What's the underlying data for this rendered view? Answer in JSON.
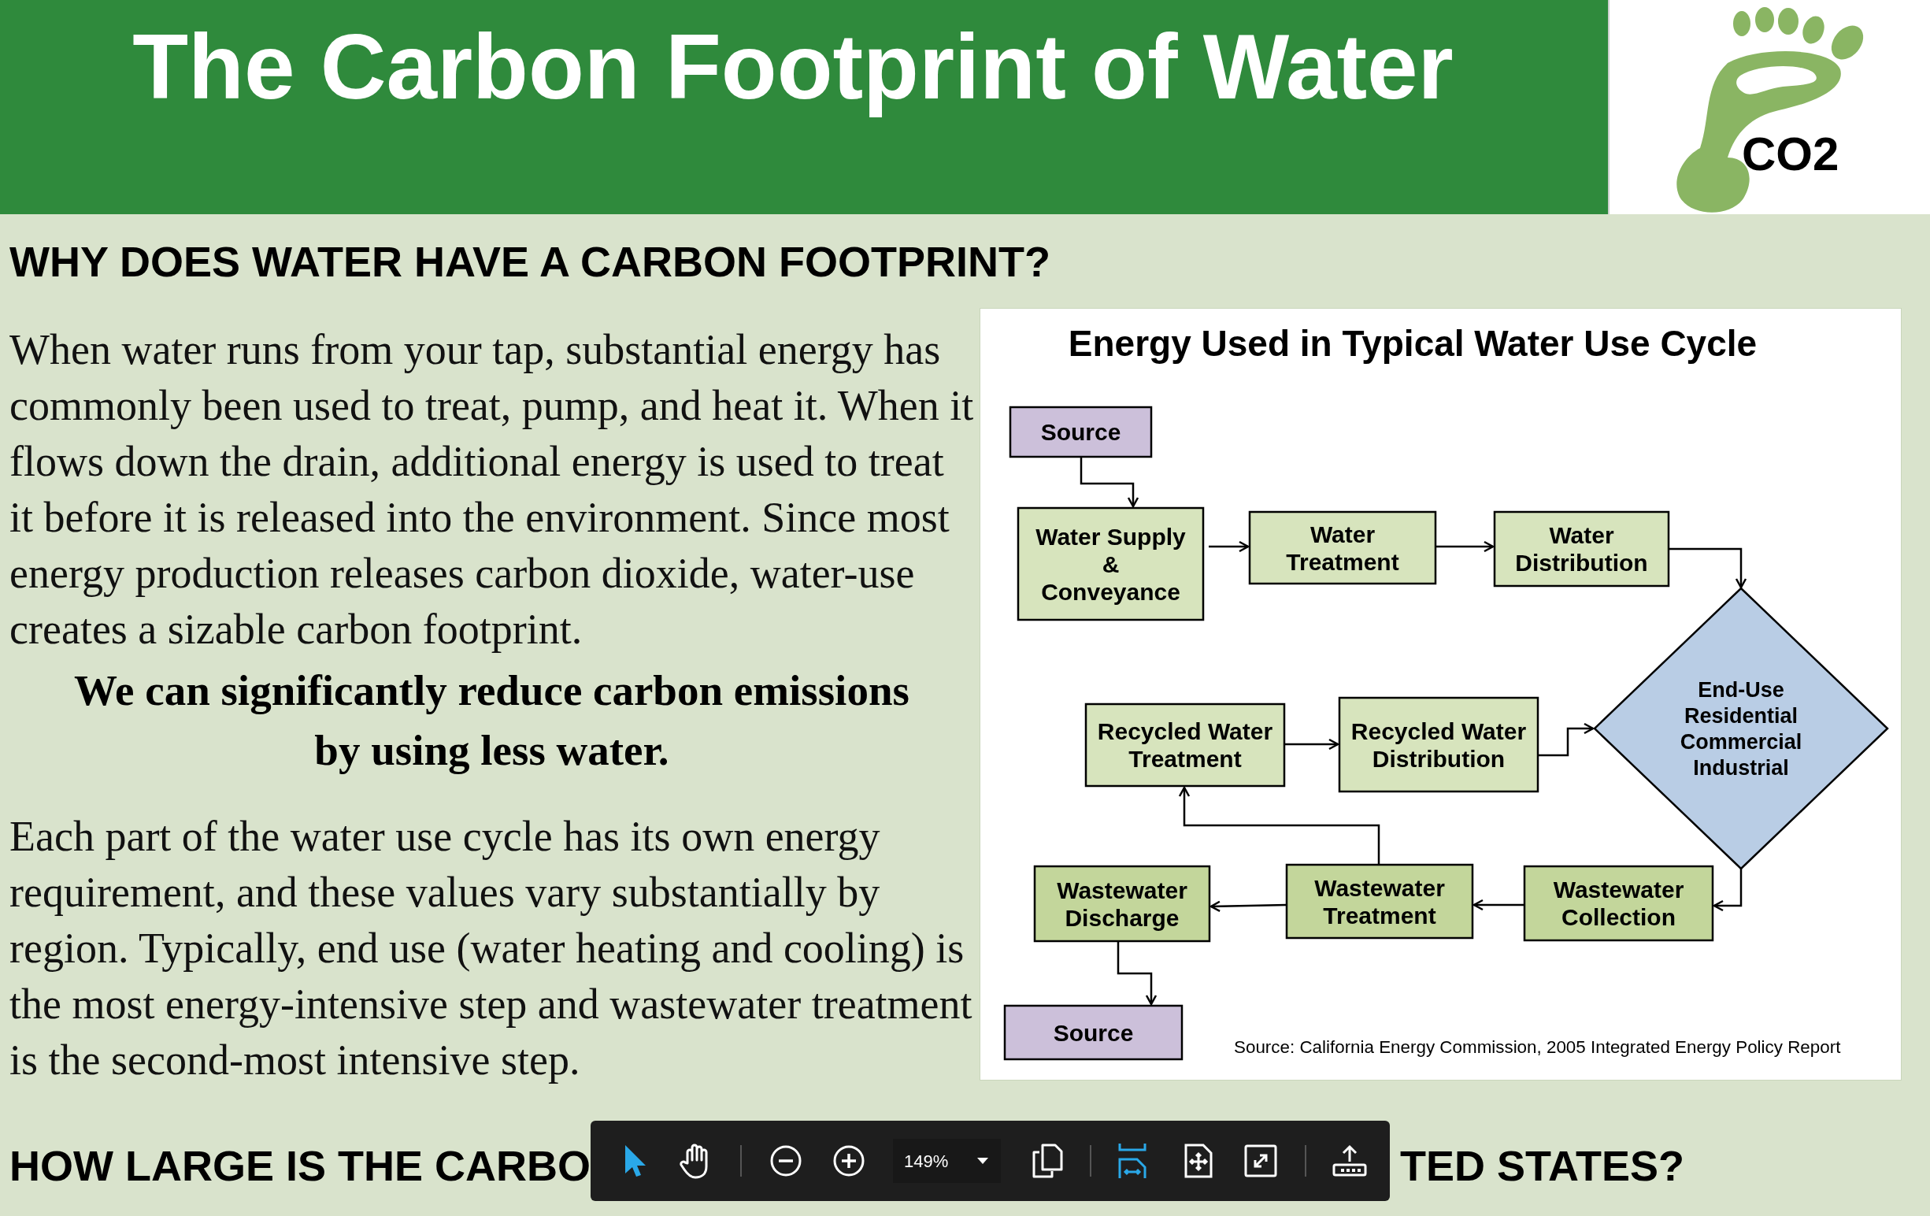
{
  "header": {
    "title": "The Carbon Footprint of Water",
    "logo_text": "CO2"
  },
  "section_1": {
    "heading": "WHY DOES WATER HAVE A CARBON FOOTPRINT?",
    "paragraphs": [
      {
        "kind": "body",
        "text": "When water runs from your tap, substantial energy has commonly been used to treat, pump, and heat it. When it flows down the drain, additional energy is used to treat it before it is released into the environment. Since most energy production releases carbon dioxide, water-use creates a sizable carbon footprint."
      },
      {
        "kind": "emphasis",
        "text": "We can significantly reduce carbon emissions by using less water."
      },
      {
        "kind": "body",
        "text": "Each part of the water use cycle has its own energy requirement, and these values vary substantially by region. Typically, end use (water heating and cooling) is the most energy-intensive step and wastewater treatment is the second-most intensive step."
      }
    ]
  },
  "diagram": {
    "title": "Energy Used in Typical Water Use Cycle",
    "nodes": [
      {
        "kind": "source",
        "lines": [
          "Source"
        ]
      },
      {
        "kind": "supply",
        "lines": [
          "Water Supply",
          "&",
          "Conveyance"
        ]
      },
      {
        "kind": "supply",
        "lines": [
          "Water",
          "Treatment"
        ]
      },
      {
        "kind": "supply",
        "lines": [
          "Water",
          "Distribution"
        ]
      },
      {
        "kind": "supply",
        "lines": [
          "Recycled Water",
          "Treatment"
        ]
      },
      {
        "kind": "supply",
        "lines": [
          "Recycled Water",
          "Distribution"
        ]
      },
      {
        "kind": "end-use",
        "lines": [
          "End-Use",
          "Residential",
          "Commercial",
          "Industrial"
        ]
      },
      {
        "kind": "wastewater",
        "lines": [
          "Wastewater",
          "Discharge"
        ]
      },
      {
        "kind": "wastewater",
        "lines": [
          "Wastewater",
          "Treatment"
        ]
      },
      {
        "kind": "wastewater",
        "lines": [
          "Wastewater",
          "Collection"
        ]
      },
      {
        "kind": "source",
        "lines": [
          "Source"
        ]
      }
    ],
    "citation": "Source: California Energy Commission, 2005 Integrated Energy Policy Report"
  },
  "section_2": {
    "heading_parts": [
      "HOW LARGE IS THE CARBO",
      "TED STATES?"
    ]
  },
  "toolbar": {
    "tools": [
      {
        "kind": "select",
        "selected": true
      },
      {
        "kind": "hand",
        "selected": false
      }
    ],
    "zoom_level": "149%",
    "views": [
      {
        "kind": "fit-width",
        "selected": true
      },
      {
        "kind": "fit-page",
        "selected": false
      }
    ]
  }
}
